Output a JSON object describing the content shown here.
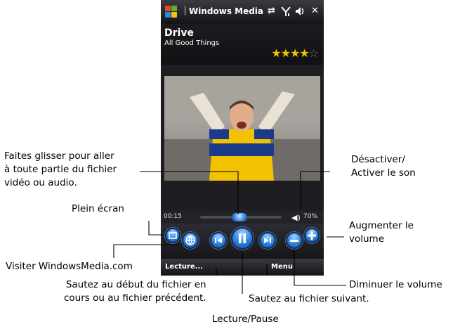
{
  "titlebar": {
    "app_name": "Windows Media",
    "icons": [
      "windows-start-icon",
      "connectivity-icon",
      "signal-icon",
      "volume-icon",
      "close-icon"
    ]
  },
  "track": {
    "title": "Drive",
    "artist": "All Good Things",
    "rating": 4,
    "rating_max": 5
  },
  "playback": {
    "elapsed": "00:15",
    "position": 0.48,
    "volume": "70%"
  },
  "softkeys": {
    "left": "Lecture...",
    "right": "Menu"
  },
  "annotations": {
    "seek": "Faites glisser pour aller\nà toute partie du fichier\nvidéo ou audio.",
    "fullscreen": "Plein écran",
    "visit": "Visiter WindowsMedia.com",
    "prev": "Sautez au début du fichier en\ncours ou au fichier précédent.",
    "playpause": "Lecture/Pause",
    "next": "Sautez au fichier suivant.",
    "vol_down": "Diminuer le volume",
    "vol_up": "Augmenter le\nvolume",
    "mute": "Désactiver/\nActiver le son"
  },
  "colors": {
    "accent_blue": "#2a7fde",
    "star": "#f5c400",
    "device": "#1d1d22"
  }
}
